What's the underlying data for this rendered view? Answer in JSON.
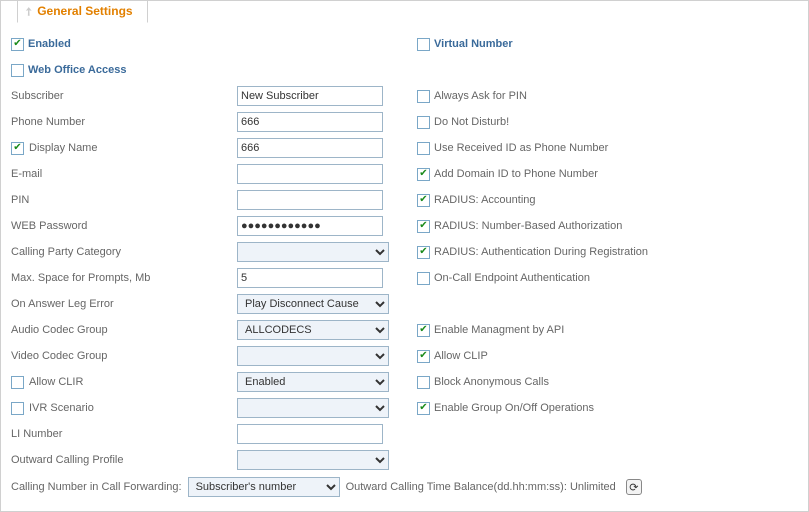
{
  "tab_title": "General Settings",
  "top": {
    "enabled": {
      "label": "Enabled",
      "checked": true
    },
    "virtual_number": {
      "label": "Virtual Number",
      "checked": false
    },
    "web_office": {
      "label": "Web Office Access",
      "checked": false
    }
  },
  "rows": [
    {
      "label": "Subscriber",
      "lcb": null,
      "ctrl": "text",
      "value": "New Subscriber",
      "rcb": false,
      "rlabel": "Always Ask for PIN"
    },
    {
      "label": "Phone Number",
      "lcb": null,
      "ctrl": "text",
      "value": "666",
      "rcb": false,
      "rlabel": "Do Not Disturb!"
    },
    {
      "label": "Display Name",
      "lcb": true,
      "ctrl": "text",
      "value": "666",
      "rcb": false,
      "rlabel": "Use Received ID as Phone Number"
    },
    {
      "label": "E-mail",
      "lcb": null,
      "ctrl": "text",
      "value": "",
      "rcb": true,
      "rlabel": "Add Domain ID to Phone Number"
    },
    {
      "label": "PIN",
      "lcb": null,
      "ctrl": "text",
      "value": "",
      "rcb": true,
      "rlabel": "RADIUS: Accounting"
    },
    {
      "label": "WEB Password",
      "lcb": null,
      "ctrl": "password",
      "value": "●●●●●●●●●●●●",
      "rcb": true,
      "rlabel": "RADIUS: Number-Based Authorization"
    },
    {
      "label": "Calling Party Category",
      "lcb": null,
      "ctrl": "select",
      "value": "",
      "rcb": true,
      "rlabel": "RADIUS: Authentication During Registration"
    },
    {
      "label": "Max. Space for Prompts, Mb",
      "lcb": null,
      "ctrl": "text",
      "value": "5",
      "rcb": false,
      "rlabel": "On-Call Endpoint Authentication"
    },
    {
      "label": "On Answer Leg Error",
      "lcb": null,
      "ctrl": "select",
      "value": "Play Disconnect Cause",
      "rcb": null,
      "rlabel": ""
    },
    {
      "label": "Audio Codec Group",
      "lcb": null,
      "ctrl": "select",
      "value": "ALLCODECS",
      "rcb": true,
      "rlabel": "Enable Managment by API"
    },
    {
      "label": "Video Codec Group",
      "lcb": null,
      "ctrl": "select",
      "value": "",
      "rcb": true,
      "rlabel": "Allow CLIP"
    },
    {
      "label": "Allow CLIR",
      "lcb": false,
      "ctrl": "select",
      "value": "Enabled",
      "rcb": false,
      "rlabel": "Block Anonymous Calls"
    },
    {
      "label": "IVR Scenario",
      "lcb": false,
      "ctrl": "select",
      "value": "",
      "rcb": true,
      "rlabel": "Enable Group On/Off Operations"
    },
    {
      "label": "LI Number",
      "lcb": null,
      "ctrl": "text",
      "value": "",
      "rcb": null,
      "rlabel": ""
    },
    {
      "label": "Outward Calling Profile",
      "lcb": null,
      "ctrl": "select",
      "value": "",
      "rcb": null,
      "rlabel": ""
    }
  ],
  "last": {
    "left_label": "Calling Number in Call Forwarding:",
    "select_value": "Subscriber's number",
    "right_text": "Outward Calling Time Balance(dd.hh:mm:ss): Unlimited"
  }
}
